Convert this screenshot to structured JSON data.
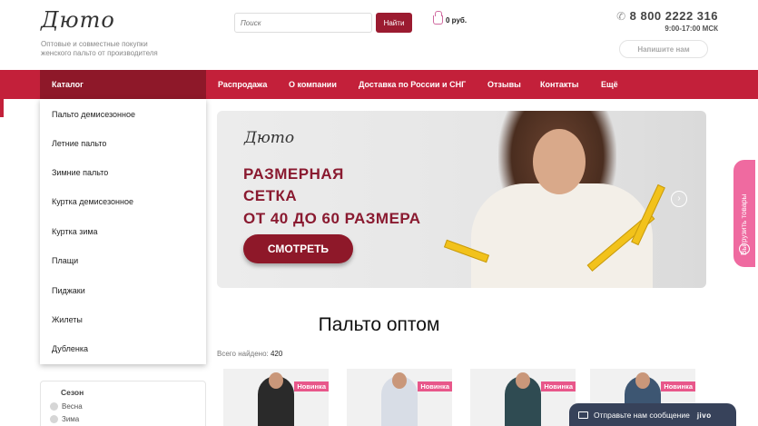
{
  "header": {
    "logo": "Дюто",
    "tagline": "Оптовые и совместные покупки женского пальто от производителя",
    "search_placeholder": "Поиск",
    "search_button": "Найти",
    "cart_total": "0 руб.",
    "phone": "8 800 2222 316",
    "hours": "9:00-17:00 МСК",
    "write_button": "Напишите нам"
  },
  "nav": {
    "catalog": "Каталог",
    "items": [
      "Распродажа",
      "О компании",
      "Доставка по России и СНГ",
      "Отзывы",
      "Контакты",
      "Ещё"
    ]
  },
  "catalog_menu": {
    "items": [
      "Пальто демисезонное",
      "Летние пальто",
      "Зимние пальто",
      "Куртка демисезонное",
      "Куртка зима",
      "Плащи",
      "Пиджаки",
      "Жилеты",
      "Дубленка"
    ]
  },
  "banner": {
    "logo": "Дюто",
    "line1": "РАЗМЕРНАЯ",
    "line2": "СЕТКА",
    "line3": "ОТ 40 ДО 60 РАЗМЕРА",
    "button": "СМОТРЕТЬ"
  },
  "page": {
    "title": "Пальто оптом",
    "found_label": "Всего найдено:",
    "found_count": "420"
  },
  "products": [
    {
      "badge": "Новинка",
      "color": "#2a2a2a"
    },
    {
      "badge": "Новинка",
      "color": "#d8dde6"
    },
    {
      "badge": "Новинка",
      "color": "#2f4b52"
    },
    {
      "badge": "Новинка",
      "color": "#3d5672"
    }
  ],
  "filter": {
    "title": "Сезон",
    "options": [
      "Весна",
      "Зима"
    ]
  },
  "side_tab": {
    "label": "Выгрузить товары"
  },
  "chat": {
    "label": "Отправьте нам сообщение",
    "brand": "jivo"
  },
  "colors": {
    "nav": "#c3203a",
    "catalog": "#8e1829",
    "accent_pink": "#ef6aa0",
    "badge": "#e8578a"
  }
}
